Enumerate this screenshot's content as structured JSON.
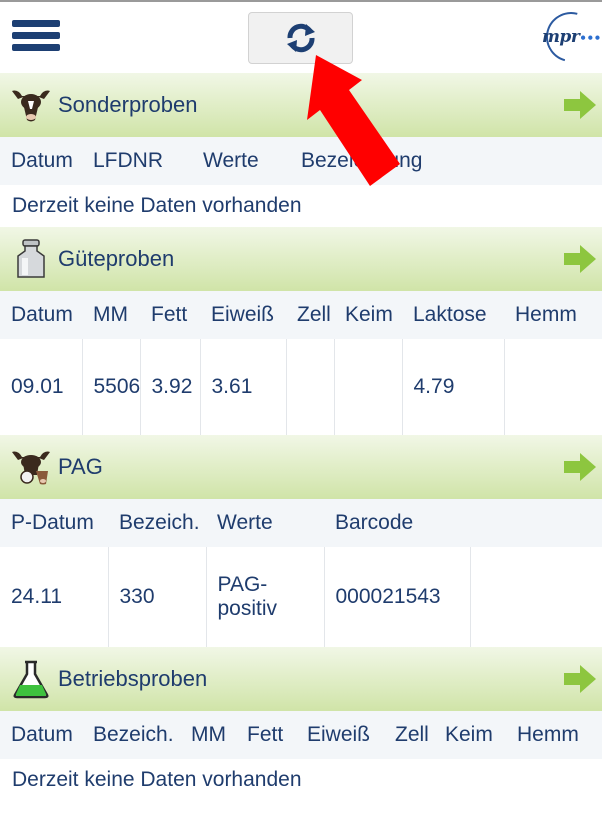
{
  "header": {
    "menu_icon": "hamburger-menu-icon",
    "refresh_icon": "refresh-icon",
    "logo_text": "mpr",
    "logo_dots": "•••"
  },
  "colors": {
    "navy": "#1d3f73",
    "section_green": "#d0e4a8",
    "arrow_green": "#8dc63f",
    "annotation_red": "#ff0000"
  },
  "sonderproben": {
    "title": "Sonderproben",
    "icon": "cow-head-icon",
    "columns": [
      "Datum",
      "LFDNR",
      "Werte",
      "Bezeichnung"
    ],
    "empty_text": "Derzeit keine Daten vorhanden"
  },
  "gueteproben": {
    "title": "Güteproben",
    "icon": "milk-can-icon",
    "columns": [
      "Datum",
      "MM",
      "Fett",
      "Eiweiß",
      "Zell",
      "Keim",
      "Laktose",
      "Hemm"
    ],
    "rows": [
      [
        "09.01",
        "5506",
        "3.92",
        "3.61",
        "",
        "",
        "4.79",
        ""
      ]
    ]
  },
  "pag": {
    "title": "PAG",
    "icon": "cow-pregnancy-icon",
    "columns": [
      "P-Datum",
      "Bezeich.",
      "Werte",
      "Barcode",
      ""
    ],
    "rows": [
      [
        "24.11",
        "330",
        "PAG-positiv",
        "000021543",
        ""
      ]
    ]
  },
  "betriebsproben": {
    "title": "Betriebsproben",
    "icon": "flask-icon",
    "columns": [
      "Datum",
      "Bezeich.",
      "MM",
      "Fett",
      "Eiweiß",
      "Zell",
      "Keim",
      "Hemm"
    ],
    "empty_text": "Derzeit keine Daten vorhanden"
  }
}
